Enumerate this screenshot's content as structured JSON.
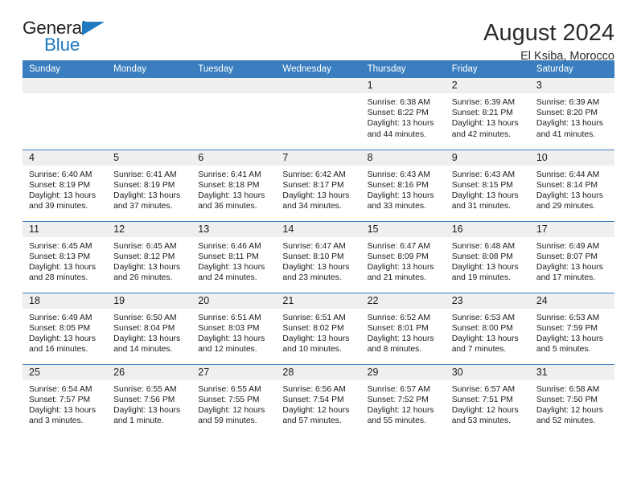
{
  "brand": {
    "name_part1": "General",
    "name_part2": "Blue",
    "triangle_color": "#1f7ac0"
  },
  "header": {
    "title": "August 2024",
    "location": "El Ksiba, Morocco"
  },
  "theme": {
    "header_bar": "#3b7ebf",
    "daynum_band": "#efeff0",
    "text": "#1b1b1b"
  },
  "calendar": {
    "weekday_headers": [
      "Sunday",
      "Monday",
      "Tuesday",
      "Wednesday",
      "Thursday",
      "Friday",
      "Saturday"
    ],
    "weeks": [
      [
        {
          "day": "",
          "lines": []
        },
        {
          "day": "",
          "lines": []
        },
        {
          "day": "",
          "lines": []
        },
        {
          "day": "",
          "lines": []
        },
        {
          "day": "1",
          "lines": [
            "Sunrise: 6:38 AM",
            "Sunset: 8:22 PM",
            "Daylight: 13 hours",
            "and 44 minutes."
          ]
        },
        {
          "day": "2",
          "lines": [
            "Sunrise: 6:39 AM",
            "Sunset: 8:21 PM",
            "Daylight: 13 hours",
            "and 42 minutes."
          ]
        },
        {
          "day": "3",
          "lines": [
            "Sunrise: 6:39 AM",
            "Sunset: 8:20 PM",
            "Daylight: 13 hours",
            "and 41 minutes."
          ]
        }
      ],
      [
        {
          "day": "4",
          "lines": [
            "Sunrise: 6:40 AM",
            "Sunset: 8:19 PM",
            "Daylight: 13 hours",
            "and 39 minutes."
          ]
        },
        {
          "day": "5",
          "lines": [
            "Sunrise: 6:41 AM",
            "Sunset: 8:19 PM",
            "Daylight: 13 hours",
            "and 37 minutes."
          ]
        },
        {
          "day": "6",
          "lines": [
            "Sunrise: 6:41 AM",
            "Sunset: 8:18 PM",
            "Daylight: 13 hours",
            "and 36 minutes."
          ]
        },
        {
          "day": "7",
          "lines": [
            "Sunrise: 6:42 AM",
            "Sunset: 8:17 PM",
            "Daylight: 13 hours",
            "and 34 minutes."
          ]
        },
        {
          "day": "8",
          "lines": [
            "Sunrise: 6:43 AM",
            "Sunset: 8:16 PM",
            "Daylight: 13 hours",
            "and 33 minutes."
          ]
        },
        {
          "day": "9",
          "lines": [
            "Sunrise: 6:43 AM",
            "Sunset: 8:15 PM",
            "Daylight: 13 hours",
            "and 31 minutes."
          ]
        },
        {
          "day": "10",
          "lines": [
            "Sunrise: 6:44 AM",
            "Sunset: 8:14 PM",
            "Daylight: 13 hours",
            "and 29 minutes."
          ]
        }
      ],
      [
        {
          "day": "11",
          "lines": [
            "Sunrise: 6:45 AM",
            "Sunset: 8:13 PM",
            "Daylight: 13 hours",
            "and 28 minutes."
          ]
        },
        {
          "day": "12",
          "lines": [
            "Sunrise: 6:45 AM",
            "Sunset: 8:12 PM",
            "Daylight: 13 hours",
            "and 26 minutes."
          ]
        },
        {
          "day": "13",
          "lines": [
            "Sunrise: 6:46 AM",
            "Sunset: 8:11 PM",
            "Daylight: 13 hours",
            "and 24 minutes."
          ]
        },
        {
          "day": "14",
          "lines": [
            "Sunrise: 6:47 AM",
            "Sunset: 8:10 PM",
            "Daylight: 13 hours",
            "and 23 minutes."
          ]
        },
        {
          "day": "15",
          "lines": [
            "Sunrise: 6:47 AM",
            "Sunset: 8:09 PM",
            "Daylight: 13 hours",
            "and 21 minutes."
          ]
        },
        {
          "day": "16",
          "lines": [
            "Sunrise: 6:48 AM",
            "Sunset: 8:08 PM",
            "Daylight: 13 hours",
            "and 19 minutes."
          ]
        },
        {
          "day": "17",
          "lines": [
            "Sunrise: 6:49 AM",
            "Sunset: 8:07 PM",
            "Daylight: 13 hours",
            "and 17 minutes."
          ]
        }
      ],
      [
        {
          "day": "18",
          "lines": [
            "Sunrise: 6:49 AM",
            "Sunset: 8:05 PM",
            "Daylight: 13 hours",
            "and 16 minutes."
          ]
        },
        {
          "day": "19",
          "lines": [
            "Sunrise: 6:50 AM",
            "Sunset: 8:04 PM",
            "Daylight: 13 hours",
            "and 14 minutes."
          ]
        },
        {
          "day": "20",
          "lines": [
            "Sunrise: 6:51 AM",
            "Sunset: 8:03 PM",
            "Daylight: 13 hours",
            "and 12 minutes."
          ]
        },
        {
          "day": "21",
          "lines": [
            "Sunrise: 6:51 AM",
            "Sunset: 8:02 PM",
            "Daylight: 13 hours",
            "and 10 minutes."
          ]
        },
        {
          "day": "22",
          "lines": [
            "Sunrise: 6:52 AM",
            "Sunset: 8:01 PM",
            "Daylight: 13 hours",
            "and 8 minutes."
          ]
        },
        {
          "day": "23",
          "lines": [
            "Sunrise: 6:53 AM",
            "Sunset: 8:00 PM",
            "Daylight: 13 hours",
            "and 7 minutes."
          ]
        },
        {
          "day": "24",
          "lines": [
            "Sunrise: 6:53 AM",
            "Sunset: 7:59 PM",
            "Daylight: 13 hours",
            "and 5 minutes."
          ]
        }
      ],
      [
        {
          "day": "25",
          "lines": [
            "Sunrise: 6:54 AM",
            "Sunset: 7:57 PM",
            "Daylight: 13 hours",
            "and 3 minutes."
          ]
        },
        {
          "day": "26",
          "lines": [
            "Sunrise: 6:55 AM",
            "Sunset: 7:56 PM",
            "Daylight: 13 hours",
            "and 1 minute."
          ]
        },
        {
          "day": "27",
          "lines": [
            "Sunrise: 6:55 AM",
            "Sunset: 7:55 PM",
            "Daylight: 12 hours",
            "and 59 minutes."
          ]
        },
        {
          "day": "28",
          "lines": [
            "Sunrise: 6:56 AM",
            "Sunset: 7:54 PM",
            "Daylight: 12 hours",
            "and 57 minutes."
          ]
        },
        {
          "day": "29",
          "lines": [
            "Sunrise: 6:57 AM",
            "Sunset: 7:52 PM",
            "Daylight: 12 hours",
            "and 55 minutes."
          ]
        },
        {
          "day": "30",
          "lines": [
            "Sunrise: 6:57 AM",
            "Sunset: 7:51 PM",
            "Daylight: 12 hours",
            "and 53 minutes."
          ]
        },
        {
          "day": "31",
          "lines": [
            "Sunrise: 6:58 AM",
            "Sunset: 7:50 PM",
            "Daylight: 12 hours",
            "and 52 minutes."
          ]
        }
      ]
    ]
  }
}
